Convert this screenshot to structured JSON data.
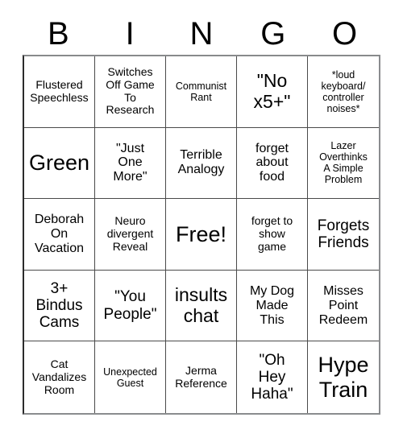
{
  "card": {
    "header_letters": [
      "B",
      "I",
      "N",
      "G",
      "O"
    ],
    "rows": [
      [
        {
          "text": "Flustered\nSpeechless",
          "size": "sz-s"
        },
        {
          "text": "Switches\nOff Game\nTo\nResearch",
          "size": "sz-s"
        },
        {
          "text": "Communist\nRant",
          "size": "sz-xs"
        },
        {
          "text": "\"No\nx5+\"",
          "size": "sz-xl"
        },
        {
          "text": "*loud\nkeyboard/\ncontroller\nnoises*",
          "size": "sz-xs"
        }
      ],
      [
        {
          "text": "Green",
          "size": "sz-xxl"
        },
        {
          "text": "\"Just\nOne\nMore\"",
          "size": "sz-m"
        },
        {
          "text": "Terrible\nAnalogy",
          "size": "sz-m"
        },
        {
          "text": "forget\nabout\nfood",
          "size": "sz-m"
        },
        {
          "text": "Lazer\nOverthinks\nA Simple\nProblem",
          "size": "sz-xs"
        }
      ],
      [
        {
          "text": "Deborah\nOn\nVacation",
          "size": "sz-m"
        },
        {
          "text": "Neuro\ndivergent\nReveal",
          "size": "sz-s"
        },
        {
          "text": "Free!",
          "size": "sz-xxl"
        },
        {
          "text": "forget to\nshow\ngame",
          "size": "sz-s"
        },
        {
          "text": "Forgets\nFriends",
          "size": "sz-l"
        }
      ],
      [
        {
          "text": "3+\nBindus\nCams",
          "size": "sz-l"
        },
        {
          "text": "\"You\nPeople\"",
          "size": "sz-l"
        },
        {
          "text": "insults\nchat",
          "size": "sz-xl"
        },
        {
          "text": "My Dog\nMade\nThis",
          "size": "sz-m"
        },
        {
          "text": "Misses\nPoint\nRedeem",
          "size": "sz-m"
        }
      ],
      [
        {
          "text": "Cat\nVandalizes\nRoom",
          "size": "sz-s"
        },
        {
          "text": "Unexpected\nGuest",
          "size": "sz-xs"
        },
        {
          "text": "Jerma\nReference",
          "size": "sz-s"
        },
        {
          "text": "\"Oh\nHey\nHaha\"",
          "size": "sz-l"
        },
        {
          "text": "Hype\nTrain",
          "size": "sz-xxl"
        }
      ]
    ]
  }
}
